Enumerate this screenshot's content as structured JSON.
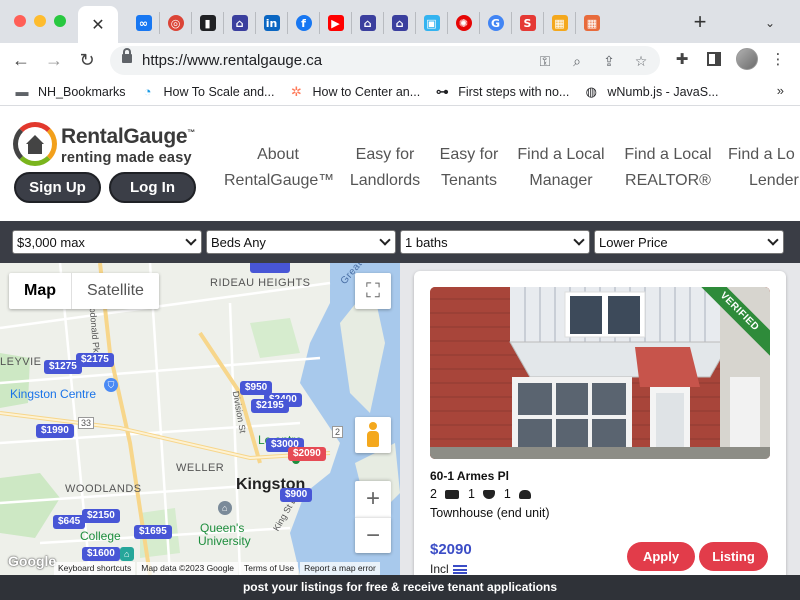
{
  "browser": {
    "active_tab_close": "✕",
    "new_tab_symbol": "+",
    "url": "https://www.rentalgauge.ca",
    "favicons": [
      {
        "icon": "meta-icon",
        "glyph": "∞",
        "color": "#1877f2",
        "round": false
      },
      {
        "icon": "chrome-colors-icon",
        "glyph": "◎",
        "color": "#db4437",
        "round": true
      },
      {
        "icon": "flag-icon",
        "glyph": "▮",
        "color": "#202124",
        "round": false
      },
      {
        "icon": "house-app-icon",
        "glyph": "⌂",
        "color": "#3b3f9e",
        "round": false
      },
      {
        "icon": "linkedin-icon",
        "glyph": "in",
        "color": "#0a66c2",
        "round": false
      },
      {
        "icon": "facebook-icon",
        "glyph": "f",
        "color": "#1877f2",
        "round": true
      },
      {
        "icon": "youtube-icon",
        "glyph": "▶",
        "color": "#ff0000",
        "round": false
      },
      {
        "icon": "house-app-icon",
        "glyph": "⌂",
        "color": "#3b3f9e",
        "round": false
      },
      {
        "icon": "house-app-icon",
        "glyph": "⌂",
        "color": "#3b3f9e",
        "round": false
      },
      {
        "icon": "squares-icon",
        "glyph": "▣",
        "color": "#33b3f0",
        "round": false
      },
      {
        "icon": "cbc-icon",
        "glyph": "✺",
        "color": "#e60505",
        "round": true
      },
      {
        "icon": "google-icon",
        "glyph": "G",
        "color": "#4285f4",
        "round": true
      },
      {
        "icon": "red-app-icon",
        "glyph": "S",
        "color": "#e53935",
        "round": false
      },
      {
        "icon": "gallery-icon",
        "glyph": "▦",
        "color": "#f4a81d",
        "round": false
      },
      {
        "icon": "gallery-icon",
        "glyph": "▦",
        "color": "#e86b3c",
        "round": false
      }
    ]
  },
  "bookmarks": [
    {
      "label": "NH_Bookmarks",
      "icon": "folder-icon",
      "color": "#5f6368"
    },
    {
      "label": "How To Scale and...",
      "icon": "blue-swirl-icon",
      "color": "#1a9be6"
    },
    {
      "label": "How to Center an...",
      "icon": "hubspot-icon",
      "color": "#ff7a59"
    },
    {
      "label": "First steps with no...",
      "icon": "link-icon",
      "color": "#202124"
    },
    {
      "label": "wNumb.js - JavaS...",
      "icon": "globe-icon",
      "color": "#202124"
    }
  ],
  "bookmarks_more": "»",
  "site": {
    "logo_name": "RentalGauge",
    "logo_tm": "™",
    "logo_tagline": "renting made easy",
    "signup_label": "Sign Up",
    "login_label": "Log In",
    "nav": [
      {
        "line1": "About",
        "line2": "RentalGauge™"
      },
      {
        "line1": "Easy for",
        "line2": "Landlords"
      },
      {
        "line1": "Easy for",
        "line2": "Tenants"
      },
      {
        "line1": "Find a Local",
        "line2": "Manager"
      },
      {
        "line1": "Find a Local",
        "line2": "REALTOR®"
      },
      {
        "line1": "Find a Lo",
        "line2": "Lender"
      }
    ]
  },
  "filters": {
    "max_price": "$3,000 max",
    "beds": "Beds Any",
    "baths": "1 baths",
    "sort": "Lower Price"
  },
  "map": {
    "tab_map": "Map",
    "tab_satellite": "Satellite",
    "zoom_in": "+",
    "zoom_out": "−",
    "fullscreen": "⛶",
    "labels": {
      "rideau_heights": "RIDEAU HEIGHTS",
      "leyvie": "LEYVIE",
      "kingston_centre": "Kingston Centre",
      "weller": "WELLER",
      "woodlands": "WOODLANDS",
      "kingston": "Kingston",
      "queens_line1": "Queen's",
      "queens_line2": "University",
      "college": "College",
      "leon_centre": "Le   entre",
      "division_st": "Division St",
      "king_st": "King St E",
      "hwy_33": "33",
      "hwy_2": "2",
      "great_c": "Great C",
      "bayridge": "bdonald Pk"
    },
    "prices": [
      {
        "label": "$1275",
        "hot": false
      },
      {
        "label": "$2175",
        "hot": false
      },
      {
        "label": "$950",
        "hot": false
      },
      {
        "label": "$2400",
        "hot": false
      },
      {
        "label": "$2195",
        "hot": false
      },
      {
        "label": "$1990",
        "hot": false
      },
      {
        "label": "$3000",
        "hot": false
      },
      {
        "label": "$2090",
        "hot": true
      },
      {
        "label": "$900",
        "hot": false
      },
      {
        "label": "$645",
        "hot": false
      },
      {
        "label": "$2150",
        "hot": false
      },
      {
        "label": "$1695",
        "hot": false
      },
      {
        "label": "$1600",
        "hot": false
      }
    ],
    "footer": {
      "google": "Google",
      "keyboard": "Keyboard shortcuts",
      "mapdata": "Map data ©2023 Google",
      "terms": "Terms of Use",
      "report": "Report a map error"
    }
  },
  "listing": {
    "badge": "VERIFIED",
    "address": "60-1 Armes Pl",
    "beds": "2",
    "baths": "1",
    "parking": "1",
    "property_type": "Townhouse (end unit)",
    "rent": "$2090",
    "included": "Incl",
    "apply_label": "Apply",
    "listing_label": "Listing"
  },
  "banner": "post your listings for free & receive tenant applications"
}
